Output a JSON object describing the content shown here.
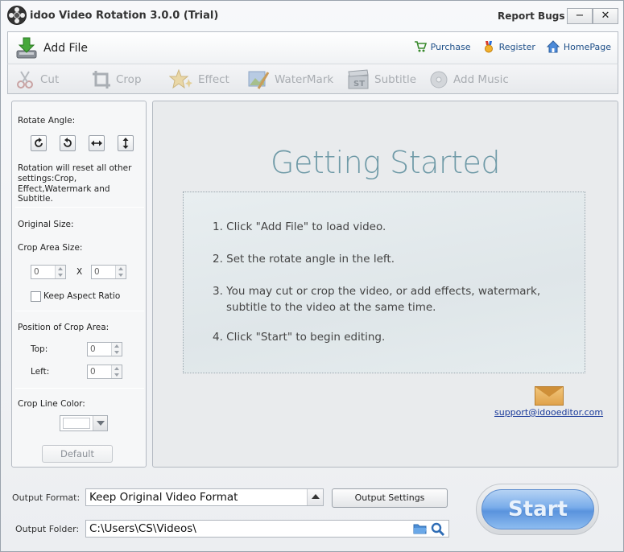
{
  "window": {
    "title": "idoo Video Rotation 3.0.0 (Trial)",
    "report_bugs": "Report Bugs",
    "minimize": "−",
    "close": "✕"
  },
  "toolbar": {
    "add_file": "Add File",
    "links": {
      "purchase": "Purchase",
      "register": "Register",
      "homepage": "HomePage"
    },
    "tools": {
      "cut": "Cut",
      "crop": "Crop",
      "effect": "Effect",
      "watermark": "WaterMark",
      "subtitle": "Subtitle",
      "add_music": "Add Music"
    }
  },
  "left_panel": {
    "rotate_angle_label": "Rotate Angle:",
    "rotation_note_line1": "Rotation will reset all other",
    "rotation_note_line2": "settings:Crop,",
    "rotation_note_line3": "Effect,Watermark and Subtitle.",
    "original_size_label": "Original Size:",
    "crop_area_size_label": "Crop Area Size:",
    "crop_width": "0",
    "crop_x": "X",
    "crop_height": "0",
    "keep_aspect_ratio": "Keep Aspect Ratio",
    "position_label": "Position of Crop Area:",
    "top_label": "Top:",
    "top_value": "0",
    "left_label": "Left:",
    "left_value": "0",
    "crop_line_color_label": "Crop Line Color:",
    "crop_line_color": "#ffffff",
    "default_button": "Default"
  },
  "main": {
    "title": "Getting Started",
    "steps": [
      "1. Click \"Add File\" to load video.",
      "2. Set the rotate angle in the left.",
      "3. You may cut or crop the video, or add effects, watermark,",
      "subtitle to the video at the same time.",
      "4. Click \"Start\" to begin editing."
    ],
    "support_email": "support@idooeditor.com"
  },
  "bottom": {
    "output_format_label": "Output Format:",
    "output_format_value": "Keep Original Video Format",
    "output_settings_button": "Output Settings",
    "output_folder_label": "Output Folder:",
    "output_folder_value": "C:\\Users\\CS\\Videos\\",
    "start_button": "Start"
  },
  "colors": {
    "accent_blue": "#6a9fe3",
    "title_teal": "#6f9aa7",
    "link_blue": "#1e4f88",
    "disabled_gray": "#a9adb2"
  }
}
